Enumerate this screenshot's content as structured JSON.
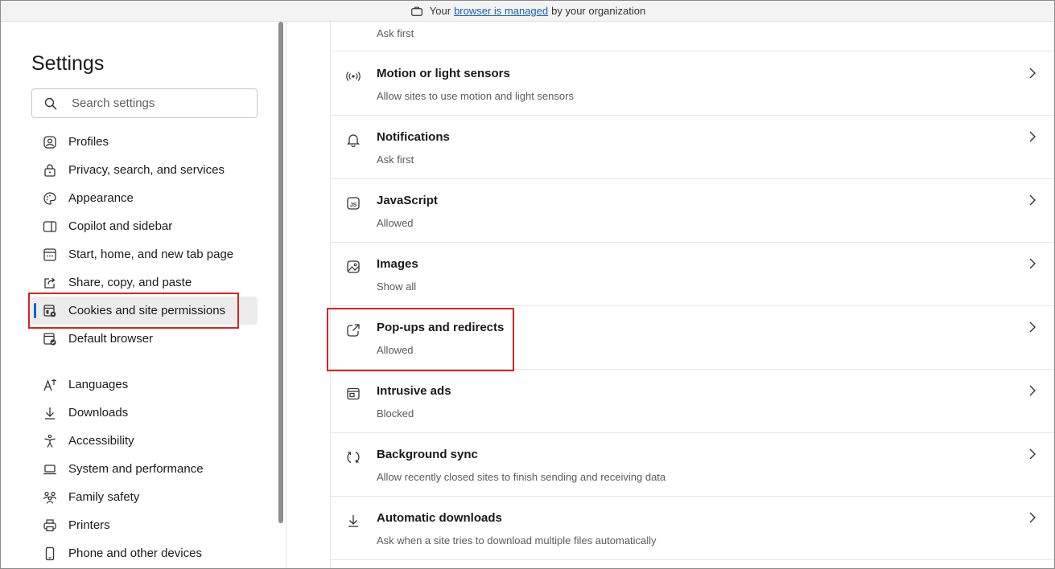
{
  "managed_bar": {
    "prefix": "Your",
    "link": "browser is managed",
    "suffix": "by your organization"
  },
  "sidebar": {
    "title": "Settings",
    "search_placeholder": "Search settings",
    "items": [
      {
        "label": "Profiles",
        "icon": "profile-icon"
      },
      {
        "label": "Privacy, search, and services",
        "icon": "lock-icon"
      },
      {
        "label": "Appearance",
        "icon": "palette-icon"
      },
      {
        "label": "Copilot and sidebar",
        "icon": "sidebar-icon"
      },
      {
        "label": "Start, home, and new tab page",
        "icon": "home-tab-icon"
      },
      {
        "label": "Share, copy, and paste",
        "icon": "share-icon"
      },
      {
        "label": "Cookies and site permissions",
        "icon": "cookies-icon",
        "active": true
      },
      {
        "label": "Default browser",
        "icon": "default-browser-icon"
      }
    ],
    "items2": [
      {
        "label": "Languages",
        "icon": "languages-icon"
      },
      {
        "label": "Downloads",
        "icon": "download-icon"
      },
      {
        "label": "Accessibility",
        "icon": "accessibility-icon"
      },
      {
        "label": "System and performance",
        "icon": "laptop-icon"
      },
      {
        "label": "Family safety",
        "icon": "family-icon"
      },
      {
        "label": "Printers",
        "icon": "printer-icon"
      },
      {
        "label": "Phone and other devices",
        "icon": "phone-icon"
      }
    ]
  },
  "content": {
    "partial_sub": "Ask first",
    "rows": [
      {
        "title": "Motion or light sensors",
        "sub": "Allow sites to use motion and light sensors",
        "icon": "sensor-icon"
      },
      {
        "title": "Notifications",
        "sub": "Ask first",
        "icon": "bell-icon"
      },
      {
        "title": "JavaScript",
        "sub": "Allowed",
        "icon": "javascript-icon"
      },
      {
        "title": "Images",
        "sub": "Show all",
        "icon": "image-icon"
      },
      {
        "title": "Pop-ups and redirects",
        "sub": "Allowed",
        "icon": "popup-icon"
      },
      {
        "title": "Intrusive ads",
        "sub": "Blocked",
        "icon": "ads-icon"
      },
      {
        "title": "Background sync",
        "sub": "Allow recently closed sites to finish sending and receiving data",
        "icon": "sync-icon"
      },
      {
        "title": "Automatic downloads",
        "sub": "Ask when a site tries to download multiple files automatically",
        "icon": "download-icon"
      }
    ]
  },
  "colors": {
    "accent": "#0067c0",
    "highlight": "#e02020",
    "link": "#1a5fb4"
  }
}
